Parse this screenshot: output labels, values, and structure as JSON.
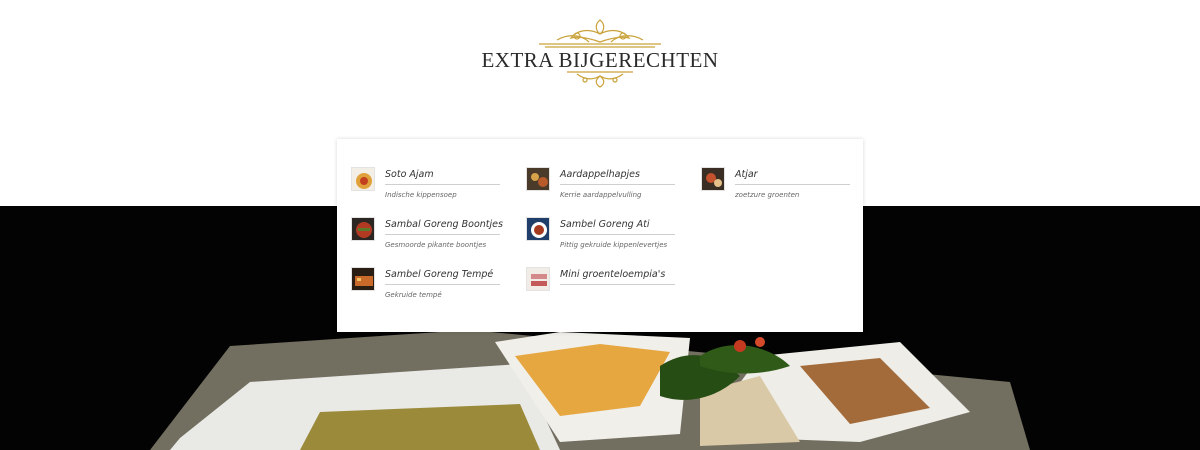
{
  "header": {
    "title": "EXTRA BIJGERECHTEN",
    "ornament_icon": "gold-flourish-ornament",
    "accent_color": "#c9a23a"
  },
  "menu": {
    "items": [
      {
        "name": "Soto Ajam",
        "description": "Indische kippensoep",
        "icon": "soup-thumbnail"
      },
      {
        "name": "Aardappelhapjes",
        "description": "Kerrie aardappelvulling",
        "icon": "snack-thumbnail"
      },
      {
        "name": "Atjar",
        "description": "zoetzure groenten",
        "icon": "pickles-thumbnail"
      },
      {
        "name": "Sambal Goreng Boontjes",
        "description": "Gesmoorde pikante boontjes",
        "icon": "beans-thumbnail"
      },
      {
        "name": "Sambel Goreng Ati",
        "description": "Pittig gekruide kippenlevertjes",
        "icon": "liver-thumbnail"
      },
      {
        "name": "Sambel Goreng Tempé",
        "description": "Gekruide tempé",
        "icon": "tempeh-thumbnail"
      },
      {
        "name": "Mini groenteloempia's",
        "description": "",
        "icon": "spring-roll-thumbnail"
      }
    ]
  },
  "background": {
    "image": "food-platter-photo",
    "color": "#030303"
  }
}
